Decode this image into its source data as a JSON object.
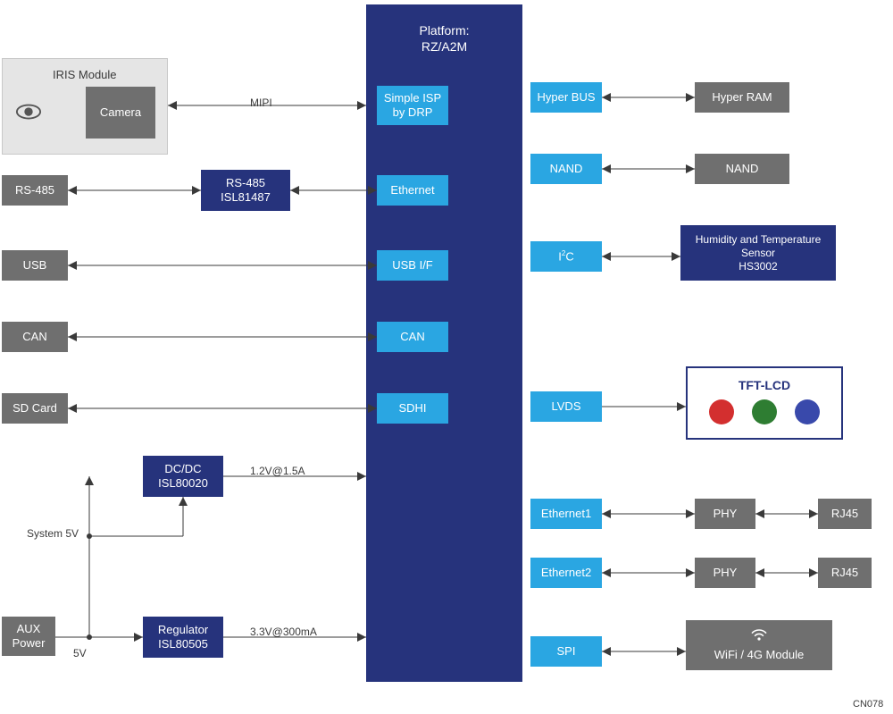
{
  "platform": {
    "title_line1": "Platform:",
    "title_line2": "RZ/A2M"
  },
  "iris": {
    "title": "IRIS Module",
    "camera": "Camera"
  },
  "left": {
    "rs485": "RS-485",
    "usb": "USB",
    "can": "CAN",
    "sdcard": "SD Card",
    "aux": "AUX\nPower"
  },
  "parts": {
    "rs485": "RS-485\nISL81487",
    "dcdc": "DC/DC\nISL80020",
    "reg": "Regulator\nISL80505"
  },
  "internal": {
    "simple_isp": "Simple ISP\nby DRP",
    "ethernet": "Ethernet",
    "usbif": "USB I/F",
    "can": "CAN",
    "sdhi": "SDHI",
    "hyperbus": "Hyper BUS",
    "nand": "NAND",
    "i2c": "I2C",
    "lvds": "LVDS",
    "eth1": "Ethernet1",
    "eth2": "Ethernet2",
    "spi": "SPI"
  },
  "right": {
    "hyperram": "Hyper RAM",
    "nand": "NAND",
    "humidity": "Humidity and Temperature\nSensor\nHS3002",
    "tft_title": "TFT-LCD",
    "phy1": "PHY",
    "phy2": "PHY",
    "rj45_1": "RJ45",
    "rj45_2": "RJ45",
    "wifi": "WiFi / 4G Module"
  },
  "labels": {
    "mipi": "MIPI",
    "v12": "1.2V@1.5A",
    "v33": "3.3V@300mA",
    "system5v": "System 5V",
    "fiveV": "5V",
    "cn": "CN078"
  },
  "colors": {
    "tft_red": "#d32f2f",
    "tft_green": "#2e7d32",
    "tft_blue": "#3949ab"
  }
}
